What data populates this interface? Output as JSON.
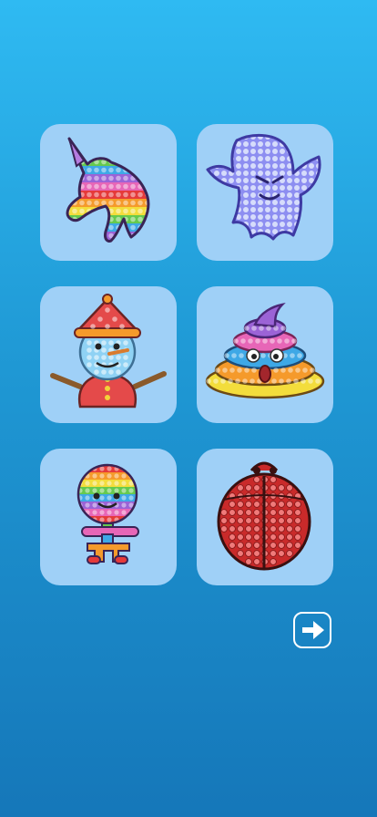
{
  "theme": {
    "card_bg": "#9fd0f7",
    "rainbow": [
      "#e53a3a",
      "#f59a2b",
      "#f3dd3c",
      "#66c94e",
      "#3ea8e6",
      "#9b63d6",
      "#e766b7"
    ],
    "ghost_fill": "#8d8ef1",
    "ghost_dot": "#d6dcfb",
    "ladybug_fill": "#c92a2a",
    "ladybug_dot": "#f07a7a"
  },
  "cards": [
    {
      "id": "unicorn",
      "icon": "unicorn-icon"
    },
    {
      "id": "ghost",
      "icon": "ghost-icon"
    },
    {
      "id": "snowman",
      "icon": "snowman-icon"
    },
    {
      "id": "poop",
      "icon": "poop-icon"
    },
    {
      "id": "lollipop-man",
      "icon": "lollipop-man-icon"
    },
    {
      "id": "ladybug",
      "icon": "ladybug-icon"
    }
  ],
  "next_button": {
    "icon": "arrow-right-icon"
  }
}
